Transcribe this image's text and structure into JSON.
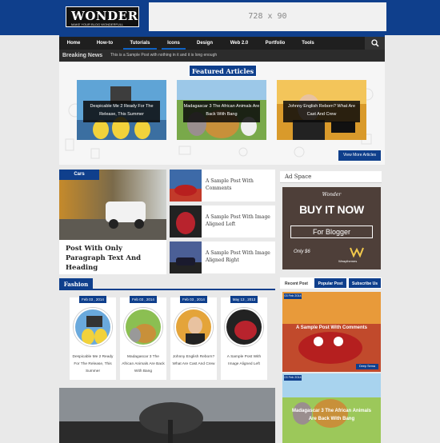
{
  "header": {
    "logo_title": "WONDER",
    "logo_tagline": "MAKE YOUR BLOG WONDERFULL",
    "ad_placeholder": "728 x 90"
  },
  "nav": {
    "items": [
      "Home",
      "How-to",
      "Tutorials",
      "Icons",
      "Design",
      "Web 2.0",
      "Portfolio",
      "Tools"
    ],
    "search_icon": "search-icon"
  },
  "breaking": {
    "label": "Breaking News",
    "text": "This is a Sample Post with nothing in it and it is long enough"
  },
  "featured": {
    "title": "Featured Articles",
    "items": [
      {
        "caption": "Despicable Me 2 Ready For The Release, This Summer"
      },
      {
        "caption": "Madagascar 3 The African Animals Are Back With Bang"
      },
      {
        "caption": "Johnny English Reborn? What Are Cast And Crew"
      }
    ],
    "view_more": "View More Articles"
  },
  "cars": {
    "tab": "Cars",
    "main_title": "Post With Only Paragraph Text And Heading",
    "side_posts": [
      {
        "title": "A Sample Post With Comments"
      },
      {
        "title": "A Sample Post With Image Aligned Left"
      },
      {
        "title": "A Sample Post With Image Aligned Right"
      }
    ]
  },
  "fashion": {
    "tab": "Fashion",
    "cards": [
      {
        "date": "Feb 03 , 2014",
        "title": "Despicable Me 2 Ready For The Release, This Summer"
      },
      {
        "date": "Feb 03 , 2014",
        "title": "Madagascar 3 The African Animals Are Back With Bang"
      },
      {
        "date": "Feb 03 , 2014",
        "title": "Johnny English Reborn? What Are Cast And Crew"
      },
      {
        "date": "May 13 , 2013",
        "title": "A Sample Post With Image Aligned Left"
      }
    ]
  },
  "sidebar": {
    "ad_title": "Ad Space",
    "ad_banner": {
      "top": "Wonder",
      "headline": "BUY IT NOW",
      "button": "For Blogger",
      "left_note": "Only $6",
      "brand": "Weaythemes"
    },
    "tabs": [
      "Recent Post",
      "Popular Post",
      "Subscribe Us"
    ],
    "posts": [
      {
        "date": "03 Feb 2014",
        "caption": "A Sample Post With Comments",
        "label": "Deep Sema"
      },
      {
        "date": "03 Feb 2014",
        "caption": "Madagascar 3 The African Animals Are Back With Bang",
        "label": ""
      }
    ]
  },
  "colors": {
    "brand_blue": "#0f3f8c",
    "nav_dark": "#1f1f1f"
  }
}
